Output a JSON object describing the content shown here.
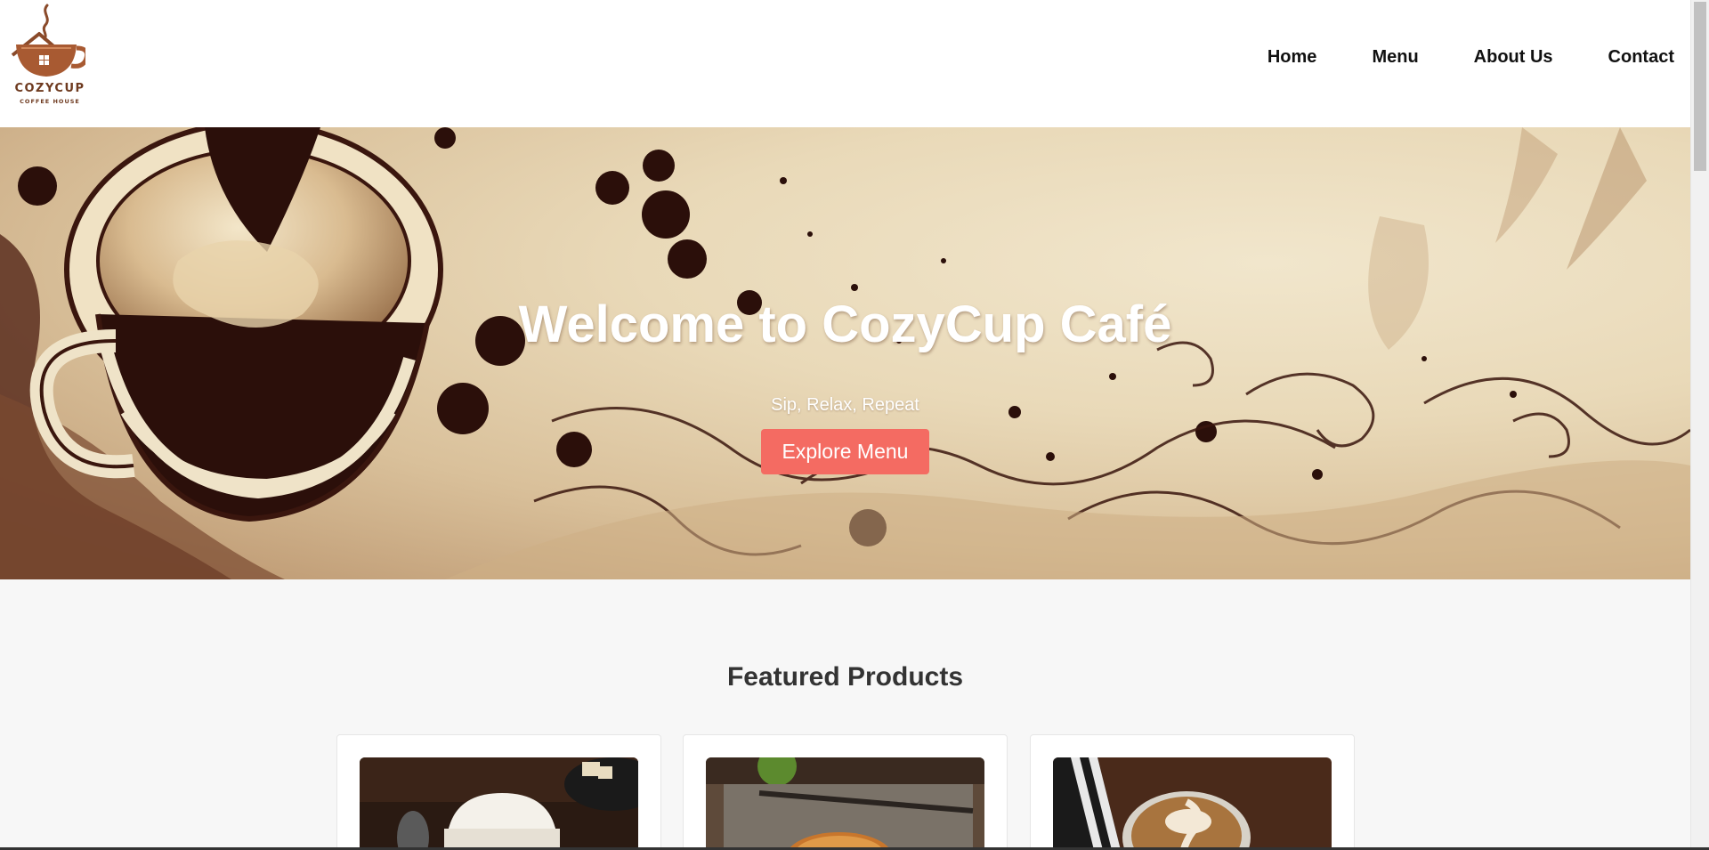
{
  "brand": {
    "name": "COZYCUP",
    "tagline": "COFFEE HOUSE"
  },
  "nav": {
    "items": [
      {
        "label": "Home"
      },
      {
        "label": "Menu"
      },
      {
        "label": "About Us"
      },
      {
        "label": "Contact"
      }
    ]
  },
  "hero": {
    "title": "Welcome to CozyCup Café",
    "subtitle": "Sip, Relax, Repeat",
    "button_label": "Explore Menu",
    "button_color": "#f46b62"
  },
  "featured": {
    "title": "Featured Products",
    "cards": [
      {
        "image": "latte-cup-image"
      },
      {
        "image": "croissant-pastry-image"
      },
      {
        "image": "latte-art-image"
      }
    ]
  },
  "colors": {
    "brand_brown": "#6e3a1f",
    "dark_coffee": "#2b0f0a",
    "cream": "#efe3c8"
  }
}
